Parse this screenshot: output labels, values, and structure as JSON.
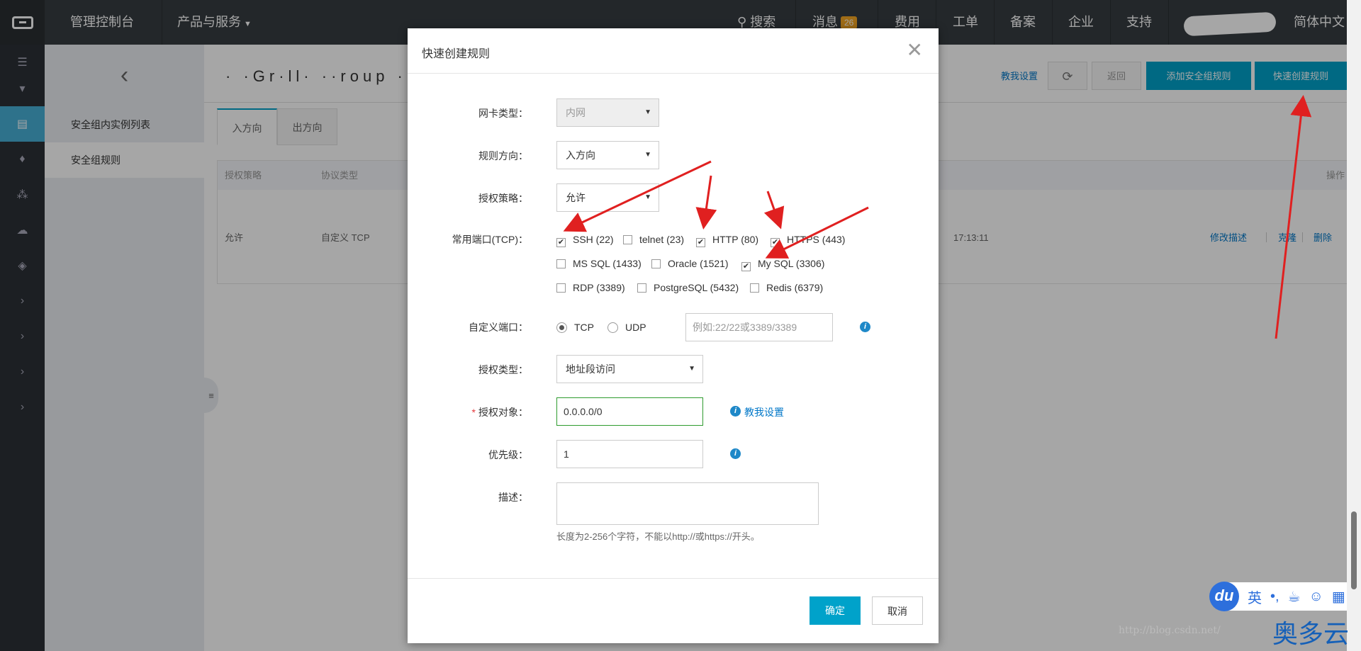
{
  "topnav": {
    "console": "管理控制台",
    "products": "产品与服务",
    "search": "搜索",
    "messages": "消息",
    "messages_count": "26",
    "billing": "费用",
    "tickets": "工单",
    "icp": "备案",
    "enterprise": "企业",
    "support": "支持",
    "language": "简体中文"
  },
  "sidebar": {
    "items": [
      "安全组内实例列表",
      "安全组规则"
    ]
  },
  "header": {
    "title": "· ·Gr·ll· ··roup ·",
    "teach": "教我设置",
    "back": "返回",
    "add_rule": "添加安全组规则",
    "quick_rule": "快速创建规则"
  },
  "tabs": [
    "入方向",
    "出方向"
  ],
  "table": {
    "columns": {
      "policy": "授权策略",
      "protocol": "协议类型",
      "action": "操作"
    },
    "row": {
      "policy": "允许",
      "protocol": "自定义 TCP",
      "time": "17:13:11",
      "edit": "修改描述",
      "clone": "克隆",
      "delete": "删除"
    }
  },
  "modal": {
    "title": "快速创建规则",
    "nic_label": "网卡类型：",
    "nic_value": "内网",
    "direction_label": "规则方向：",
    "direction_value": "入方向",
    "policy_label": "授权策略：",
    "policy_value": "允许",
    "ports_label": "常用端口(TCP)：",
    "ports": [
      {
        "label": "SSH (22)",
        "checked": true
      },
      {
        "label": "telnet (23)",
        "checked": false
      },
      {
        "label": "HTTP (80)",
        "checked": true
      },
      {
        "label": "HTTPS (443)",
        "checked": true
      },
      {
        "label": "MS SQL (1433)",
        "checked": false
      },
      {
        "label": "Oracle (1521)",
        "checked": false
      },
      {
        "label": "My SQL (3306)",
        "checked": true
      },
      {
        "label": "RDP (3389)",
        "checked": false
      },
      {
        "label": "PostgreSQL (5432)",
        "checked": false
      },
      {
        "label": "Redis (6379)",
        "checked": false
      }
    ],
    "custom_port_label": "自定义端口：",
    "tcp": "TCP",
    "udp": "UDP",
    "port_placeholder": "例如:22/22或3389/3389",
    "auth_type_label": "授权类型：",
    "auth_type_value": "地址段访问",
    "auth_object_label": "授权对象：",
    "auth_object_value": "0.0.0.0/0",
    "teach": "教我设置",
    "priority_label": "优先级：",
    "priority_value": "1",
    "desc_label": "描述：",
    "desc_hint": "长度为2-256个字符，不能以http://或https://开头。",
    "ok": "确定",
    "cancel": "取消"
  },
  "ime": {
    "du": "du",
    "lang": "英"
  },
  "watermark": "http://blog.csdn.net/",
  "brand": "奥多云",
  "colors": {
    "nav": "#373d41",
    "accent": "#00a2ca",
    "arrow": "#e02020"
  }
}
